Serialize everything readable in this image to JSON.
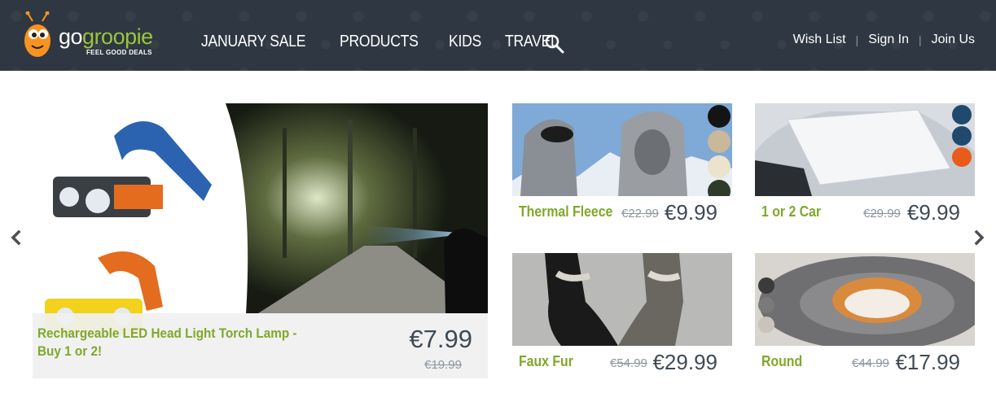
{
  "brand": {
    "name_part1": "go",
    "name_part2": "groopie",
    "tagline": "FEEL GOOD DEALS"
  },
  "nav": {
    "items": [
      "JANUARY SALE",
      "PRODUCTS",
      "KIDS",
      "TRAVEL"
    ]
  },
  "account": {
    "wishlist": "Wish List",
    "signin": "Sign In",
    "joinus": "Join Us",
    "separator": "|"
  },
  "hero": {
    "title": "Rechargeable LED Head Light Torch Lamp - Buy 1 or 2!",
    "price": "€7.99",
    "old_price": "€19.99"
  },
  "cards": [
    {
      "title": "Thermal Fleece",
      "old_price": "€22.99",
      "price": "€9.99"
    },
    {
      "title": "1 or 2 Car",
      "old_price": "€29.99",
      "price": "€9.99"
    },
    {
      "title": "Faux Fur",
      "old_price": "€54.99",
      "price": "€29.99"
    },
    {
      "title": "Round",
      "old_price": "€44.99",
      "price": "€17.99"
    }
  ],
  "colors": {
    "header": "#2f3842",
    "accent_green": "#9bc53d",
    "title_green": "#7fa82a",
    "price": "#3f4a55"
  },
  "icons": [
    "logo-bug-icon",
    "search-icon",
    "chevron-left-icon",
    "chevron-right-icon"
  ]
}
